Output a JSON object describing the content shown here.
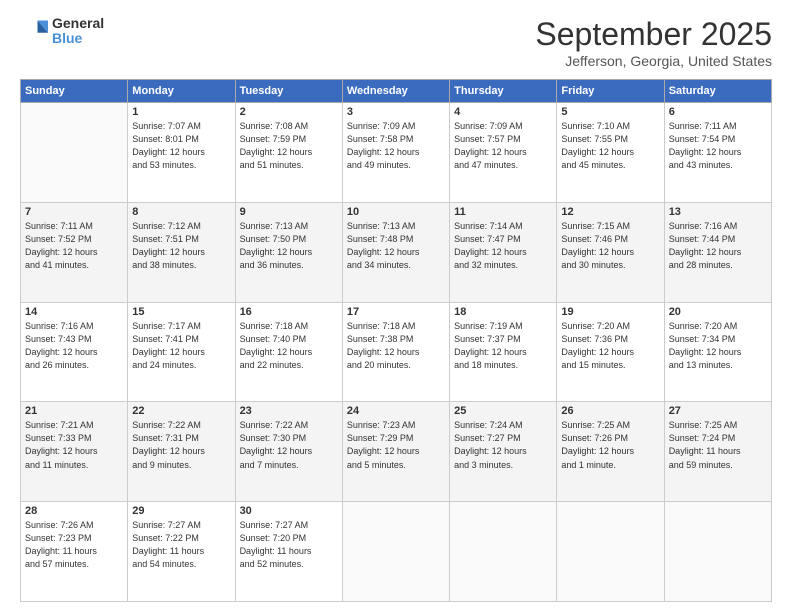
{
  "logo": {
    "general": "General",
    "blue": "Blue"
  },
  "header": {
    "title": "September 2025",
    "location": "Jefferson, Georgia, United States"
  },
  "days_of_week": [
    "Sunday",
    "Monday",
    "Tuesday",
    "Wednesday",
    "Thursday",
    "Friday",
    "Saturday"
  ],
  "weeks": [
    [
      {
        "num": "",
        "info": ""
      },
      {
        "num": "1",
        "info": "Sunrise: 7:07 AM\nSunset: 8:01 PM\nDaylight: 12 hours\nand 53 minutes."
      },
      {
        "num": "2",
        "info": "Sunrise: 7:08 AM\nSunset: 7:59 PM\nDaylight: 12 hours\nand 51 minutes."
      },
      {
        "num": "3",
        "info": "Sunrise: 7:09 AM\nSunset: 7:58 PM\nDaylight: 12 hours\nand 49 minutes."
      },
      {
        "num": "4",
        "info": "Sunrise: 7:09 AM\nSunset: 7:57 PM\nDaylight: 12 hours\nand 47 minutes."
      },
      {
        "num": "5",
        "info": "Sunrise: 7:10 AM\nSunset: 7:55 PM\nDaylight: 12 hours\nand 45 minutes."
      },
      {
        "num": "6",
        "info": "Sunrise: 7:11 AM\nSunset: 7:54 PM\nDaylight: 12 hours\nand 43 minutes."
      }
    ],
    [
      {
        "num": "7",
        "info": "Sunrise: 7:11 AM\nSunset: 7:52 PM\nDaylight: 12 hours\nand 41 minutes."
      },
      {
        "num": "8",
        "info": "Sunrise: 7:12 AM\nSunset: 7:51 PM\nDaylight: 12 hours\nand 38 minutes."
      },
      {
        "num": "9",
        "info": "Sunrise: 7:13 AM\nSunset: 7:50 PM\nDaylight: 12 hours\nand 36 minutes."
      },
      {
        "num": "10",
        "info": "Sunrise: 7:13 AM\nSunset: 7:48 PM\nDaylight: 12 hours\nand 34 minutes."
      },
      {
        "num": "11",
        "info": "Sunrise: 7:14 AM\nSunset: 7:47 PM\nDaylight: 12 hours\nand 32 minutes."
      },
      {
        "num": "12",
        "info": "Sunrise: 7:15 AM\nSunset: 7:46 PM\nDaylight: 12 hours\nand 30 minutes."
      },
      {
        "num": "13",
        "info": "Sunrise: 7:16 AM\nSunset: 7:44 PM\nDaylight: 12 hours\nand 28 minutes."
      }
    ],
    [
      {
        "num": "14",
        "info": "Sunrise: 7:16 AM\nSunset: 7:43 PM\nDaylight: 12 hours\nand 26 minutes."
      },
      {
        "num": "15",
        "info": "Sunrise: 7:17 AM\nSunset: 7:41 PM\nDaylight: 12 hours\nand 24 minutes."
      },
      {
        "num": "16",
        "info": "Sunrise: 7:18 AM\nSunset: 7:40 PM\nDaylight: 12 hours\nand 22 minutes."
      },
      {
        "num": "17",
        "info": "Sunrise: 7:18 AM\nSunset: 7:38 PM\nDaylight: 12 hours\nand 20 minutes."
      },
      {
        "num": "18",
        "info": "Sunrise: 7:19 AM\nSunset: 7:37 PM\nDaylight: 12 hours\nand 18 minutes."
      },
      {
        "num": "19",
        "info": "Sunrise: 7:20 AM\nSunset: 7:36 PM\nDaylight: 12 hours\nand 15 minutes."
      },
      {
        "num": "20",
        "info": "Sunrise: 7:20 AM\nSunset: 7:34 PM\nDaylight: 12 hours\nand 13 minutes."
      }
    ],
    [
      {
        "num": "21",
        "info": "Sunrise: 7:21 AM\nSunset: 7:33 PM\nDaylight: 12 hours\nand 11 minutes."
      },
      {
        "num": "22",
        "info": "Sunrise: 7:22 AM\nSunset: 7:31 PM\nDaylight: 12 hours\nand 9 minutes."
      },
      {
        "num": "23",
        "info": "Sunrise: 7:22 AM\nSunset: 7:30 PM\nDaylight: 12 hours\nand 7 minutes."
      },
      {
        "num": "24",
        "info": "Sunrise: 7:23 AM\nSunset: 7:29 PM\nDaylight: 12 hours\nand 5 minutes."
      },
      {
        "num": "25",
        "info": "Sunrise: 7:24 AM\nSunset: 7:27 PM\nDaylight: 12 hours\nand 3 minutes."
      },
      {
        "num": "26",
        "info": "Sunrise: 7:25 AM\nSunset: 7:26 PM\nDaylight: 12 hours\nand 1 minute."
      },
      {
        "num": "27",
        "info": "Sunrise: 7:25 AM\nSunset: 7:24 PM\nDaylight: 11 hours\nand 59 minutes."
      }
    ],
    [
      {
        "num": "28",
        "info": "Sunrise: 7:26 AM\nSunset: 7:23 PM\nDaylight: 11 hours\nand 57 minutes."
      },
      {
        "num": "29",
        "info": "Sunrise: 7:27 AM\nSunset: 7:22 PM\nDaylight: 11 hours\nand 54 minutes."
      },
      {
        "num": "30",
        "info": "Sunrise: 7:27 AM\nSunset: 7:20 PM\nDaylight: 11 hours\nand 52 minutes."
      },
      {
        "num": "",
        "info": ""
      },
      {
        "num": "",
        "info": ""
      },
      {
        "num": "",
        "info": ""
      },
      {
        "num": "",
        "info": ""
      }
    ]
  ]
}
